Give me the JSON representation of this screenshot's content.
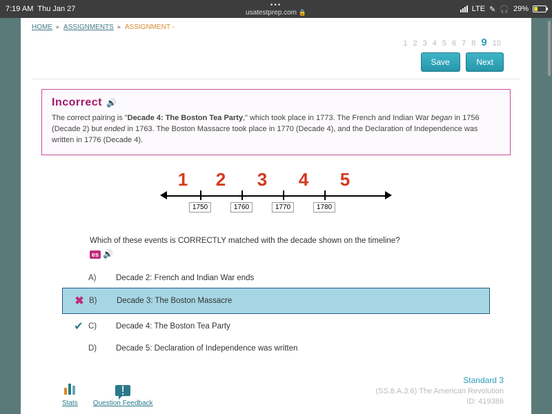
{
  "status": {
    "time": "7:19 AM",
    "date": "Thu Jan 27",
    "site": "usatestprep.com",
    "network": "LTE",
    "battery_pct": "29%"
  },
  "crumbs": {
    "home": "HOME",
    "assignments": "ASSIGNMENTS",
    "current": "ASSIGNMENT -"
  },
  "pager": {
    "items": [
      "1",
      "2",
      "3",
      "4",
      "5",
      "6",
      "7",
      "8",
      "9",
      "10"
    ],
    "current": "9"
  },
  "buttons": {
    "save": "Save",
    "next": "Next"
  },
  "feedback": {
    "title": "Incorrect",
    "html": "The correct pairing is \"<b>Decade 4: The Boston Tea Party</b>,\" which took place in 1773. The French and Indian War <i>began</i> in 1756 (Decade 2) but <i>ended</i> in 1763. The Boston Massacre took place in 1770 (Decade 4), and the Declaration of Independence was written in 1776 (Decade 4)."
  },
  "timeline": {
    "segments": [
      "1",
      "2",
      "3",
      "4",
      "5"
    ],
    "ticks": [
      "1750",
      "1760",
      "1770",
      "1780"
    ]
  },
  "question": {
    "text": "Which of these events is CORRECTLY matched with the decade shown on the timeline?",
    "es_label": "es"
  },
  "answers": [
    {
      "letter": "A)",
      "text": "Decade 2: French and Indian War ends",
      "state": ""
    },
    {
      "letter": "B)",
      "text": "Decade 3: The Boston Massacre",
      "state": "wrong"
    },
    {
      "letter": "C)",
      "text": "Decade 4: The Boston Tea Party",
      "state": "right"
    },
    {
      "letter": "D)",
      "text": "Decade 5: Declaration of Independence was written",
      "state": ""
    }
  ],
  "footer": {
    "stats": "Stats",
    "feedback": "Question Feedback",
    "standard": "Standard 3",
    "code": "(SS.8.A.3.6) The American Revolution",
    "id": "ID: 419386"
  }
}
